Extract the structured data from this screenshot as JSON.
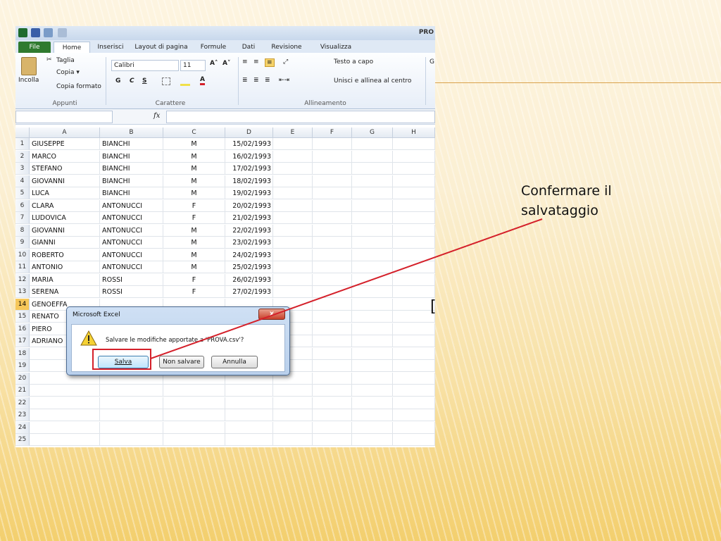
{
  "window": {
    "title": "PRO"
  },
  "ribbon": {
    "tabs": [
      "File",
      "Home",
      "Inserisci",
      "Layout di pagina",
      "Formule",
      "Dati",
      "Revisione",
      "Visualizza"
    ],
    "clipboard": {
      "paste": "Incolla",
      "cut": "Taglia",
      "copy": "Copia ▾",
      "format_painter": "Copia formato",
      "group": "Appunti"
    },
    "font": {
      "name": "Calibri",
      "size": "11",
      "bold": "G",
      "italic": "C",
      "underline": "S",
      "group": "Carattere"
    },
    "alignment": {
      "wrap": "Testo a capo",
      "merge": "Unisci e allinea al centro",
      "group": "Allineamento",
      "next_group_initial": "G"
    }
  },
  "formula_bar": {
    "fx": "fx"
  },
  "columns": [
    "A",
    "B",
    "C",
    "D",
    "E",
    "F",
    "G",
    "H"
  ],
  "rows": [
    {
      "n": "1",
      "a": "GIUSEPPE",
      "b": "BIANCHI",
      "c": "M",
      "d": "15/02/1993"
    },
    {
      "n": "2",
      "a": "MARCO",
      "b": "BIANCHI",
      "c": "M",
      "d": "16/02/1993"
    },
    {
      "n": "3",
      "a": "STEFANO",
      "b": "BIANCHI",
      "c": "M",
      "d": "17/02/1993"
    },
    {
      "n": "4",
      "a": "GIOVANNI",
      "b": "BIANCHI",
      "c": "M",
      "d": "18/02/1993"
    },
    {
      "n": "5",
      "a": "LUCA",
      "b": "BIANCHI",
      "c": "M",
      "d": "19/02/1993"
    },
    {
      "n": "6",
      "a": "CLARA",
      "b": "ANTONUCCI",
      "c": "F",
      "d": "20/02/1993"
    },
    {
      "n": "7",
      "a": "LUDOVICA",
      "b": "ANTONUCCI",
      "c": "F",
      "d": "21/02/1993"
    },
    {
      "n": "8",
      "a": "GIOVANNI",
      "b": "ANTONUCCI",
      "c": "M",
      "d": "22/02/1993"
    },
    {
      "n": "9",
      "a": "GIANNI",
      "b": "ANTONUCCI",
      "c": "M",
      "d": "23/02/1993"
    },
    {
      "n": "10",
      "a": "ROBERTO",
      "b": "ANTONUCCI",
      "c": "M",
      "d": "24/02/1993"
    },
    {
      "n": "11",
      "a": "ANTONIO",
      "b": "ANTONUCCI",
      "c": "M",
      "d": "25/02/1993"
    },
    {
      "n": "12",
      "a": "MARIA",
      "b": "ROSSI",
      "c": "F",
      "d": "26/02/1993"
    },
    {
      "n": "13",
      "a": "SERENA",
      "b": "ROSSI",
      "c": "F",
      "d": "27/02/1993"
    },
    {
      "n": "14",
      "a": "GENOEFFA",
      "b": "",
      "c": "",
      "d": ""
    },
    {
      "n": "15",
      "a": "RENATO",
      "b": "",
      "c": "",
      "d": ""
    },
    {
      "n": "16",
      "a": "PIERO",
      "b": "",
      "c": "",
      "d": ""
    },
    {
      "n": "17",
      "a": "ADRIANO",
      "b": "",
      "c": "",
      "d": ""
    },
    {
      "n": "18",
      "a": "",
      "b": "",
      "c": "",
      "d": ""
    },
    {
      "n": "19",
      "a": "",
      "b": "",
      "c": "",
      "d": ""
    },
    {
      "n": "20",
      "a": "",
      "b": "",
      "c": "",
      "d": ""
    },
    {
      "n": "21",
      "a": "",
      "b": "",
      "c": "",
      "d": ""
    },
    {
      "n": "22",
      "a": "",
      "b": "",
      "c": "",
      "d": ""
    },
    {
      "n": "23",
      "a": "",
      "b": "",
      "c": "",
      "d": ""
    },
    {
      "n": "24",
      "a": "",
      "b": "",
      "c": "",
      "d": ""
    },
    {
      "n": "25",
      "a": "",
      "b": "",
      "c": "",
      "d": ""
    }
  ],
  "selected_row": "14",
  "dialog": {
    "title": "Microsoft Excel",
    "close": "x",
    "message": "Salvare le modifiche apportate a 'PROVA.csv'?",
    "save": "Salva",
    "dont_save": "Non salvare",
    "cancel": "Annulla"
  },
  "callout": {
    "line1": "Confermare il",
    "line2": "salvataggio"
  },
  "slide_bracket": "[",
  "colors": {
    "highlight": "#d4202a",
    "accent_line": "#d9a14c",
    "selected_row": "#f6c75a"
  }
}
